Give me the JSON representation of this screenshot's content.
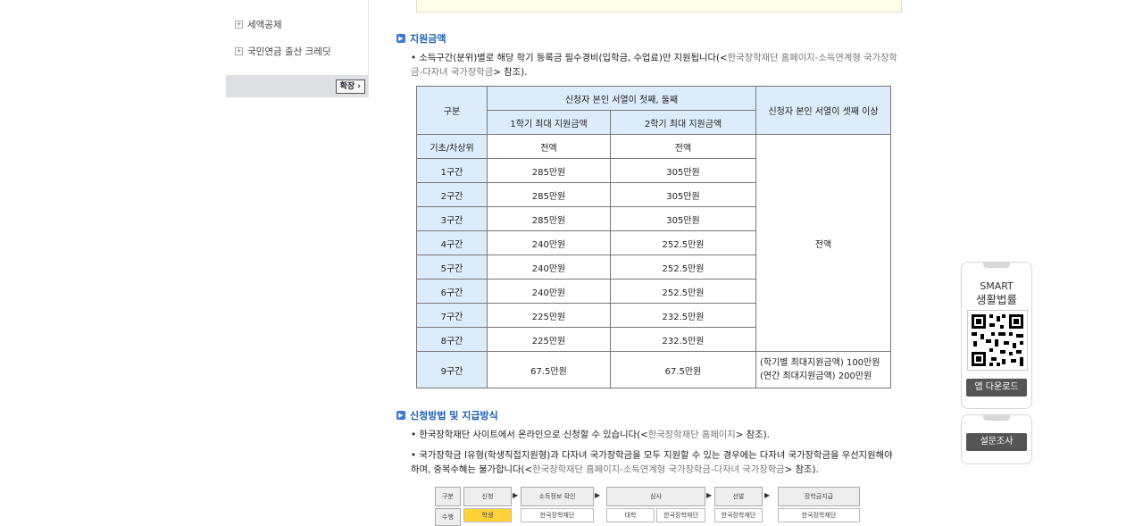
{
  "sidebar": {
    "items": [
      {
        "label": "세액공제"
      },
      {
        "label": "국민연금 출산 크레딧"
      }
    ],
    "expand_label": "확장",
    "expand_icon": "chevron-right-icon"
  },
  "sections": {
    "support": {
      "title": "지원금액",
      "para_main": "소득구간(분위)별로 해당 학기 등록금 필수경비(입학금, 수업료)만 지원됩니다(<",
      "para_link": "한국장학재단 홈페이지-소득연계형 국가장학금-다자녀 국가장학금",
      "para_tail": "> 참조)."
    },
    "apply": {
      "title": "신청방법 및 지급방식",
      "para1_main": "한국장학재단 사이트에서 온라인으로 신청할 수 있습니다(<",
      "para1_link": "한국장학재단 홈페이지",
      "para1_tail": "> 참조).",
      "para2_main": "국가장학금 I유형(학생직접지원형)과 다자녀 국가장학금을 모두 지원할 수 있는 경우에는 다자녀 국가장학금을 우선지원해야 하며, 중복수혜는 불가합니다(<",
      "para2_link": "한국장학재단 홈페이지-소득연계형 국가장학금-다자녀 국가장학금",
      "para2_tail": "> 참조)."
    }
  },
  "table": {
    "h_category": "구분",
    "h_group": "신청자 본인 서열이 첫째, 둘째",
    "h_sem1": "1학기 최대 지원금액",
    "h_sem2": "2학기 최대 지원금액",
    "h_third": "신청자 본인 서열이 셋째 이상",
    "third_value": "전액",
    "rows": [
      {
        "label": "기초/차상위",
        "s1": "전액",
        "s2": "전액"
      },
      {
        "label": "1구간",
        "s1": "285만원",
        "s2": "305만원"
      },
      {
        "label": "2구간",
        "s1": "285만원",
        "s2": "305만원"
      },
      {
        "label": "3구간",
        "s1": "285만원",
        "s2": "305만원"
      },
      {
        "label": "4구간",
        "s1": "240만원",
        "s2": "252.5만원"
      },
      {
        "label": "5구간",
        "s1": "240만원",
        "s2": "252.5만원"
      },
      {
        "label": "6구간",
        "s1": "240만원",
        "s2": "252.5만원"
      },
      {
        "label": "7구간",
        "s1": "225만원",
        "s2": "232.5만원"
      },
      {
        "label": "8구간",
        "s1": "225만원",
        "s2": "232.5만원"
      },
      {
        "label": "9구간",
        "s1": "67.5만원",
        "s2": "67.5만원",
        "third_line1": "(학기별 최대지원금액) 100만원",
        "third_line2": "(연간 최대지원금액) 200만원"
      }
    ]
  },
  "flow": {
    "steps": [
      "구분",
      "신청",
      "소득정보 확인",
      "심사",
      "선발",
      "장학금지급"
    ],
    "row_label": "수행",
    "cells": [
      "학생",
      "한국장학재단",
      "대학",
      "한국장학재단",
      "한국장학재단",
      "한국장학재단"
    ]
  },
  "widgets": {
    "app": {
      "title_line1": "SMART",
      "title_line2": "생활법률",
      "button": "앱 다운로드"
    },
    "survey": {
      "button": "설문조사"
    }
  }
}
